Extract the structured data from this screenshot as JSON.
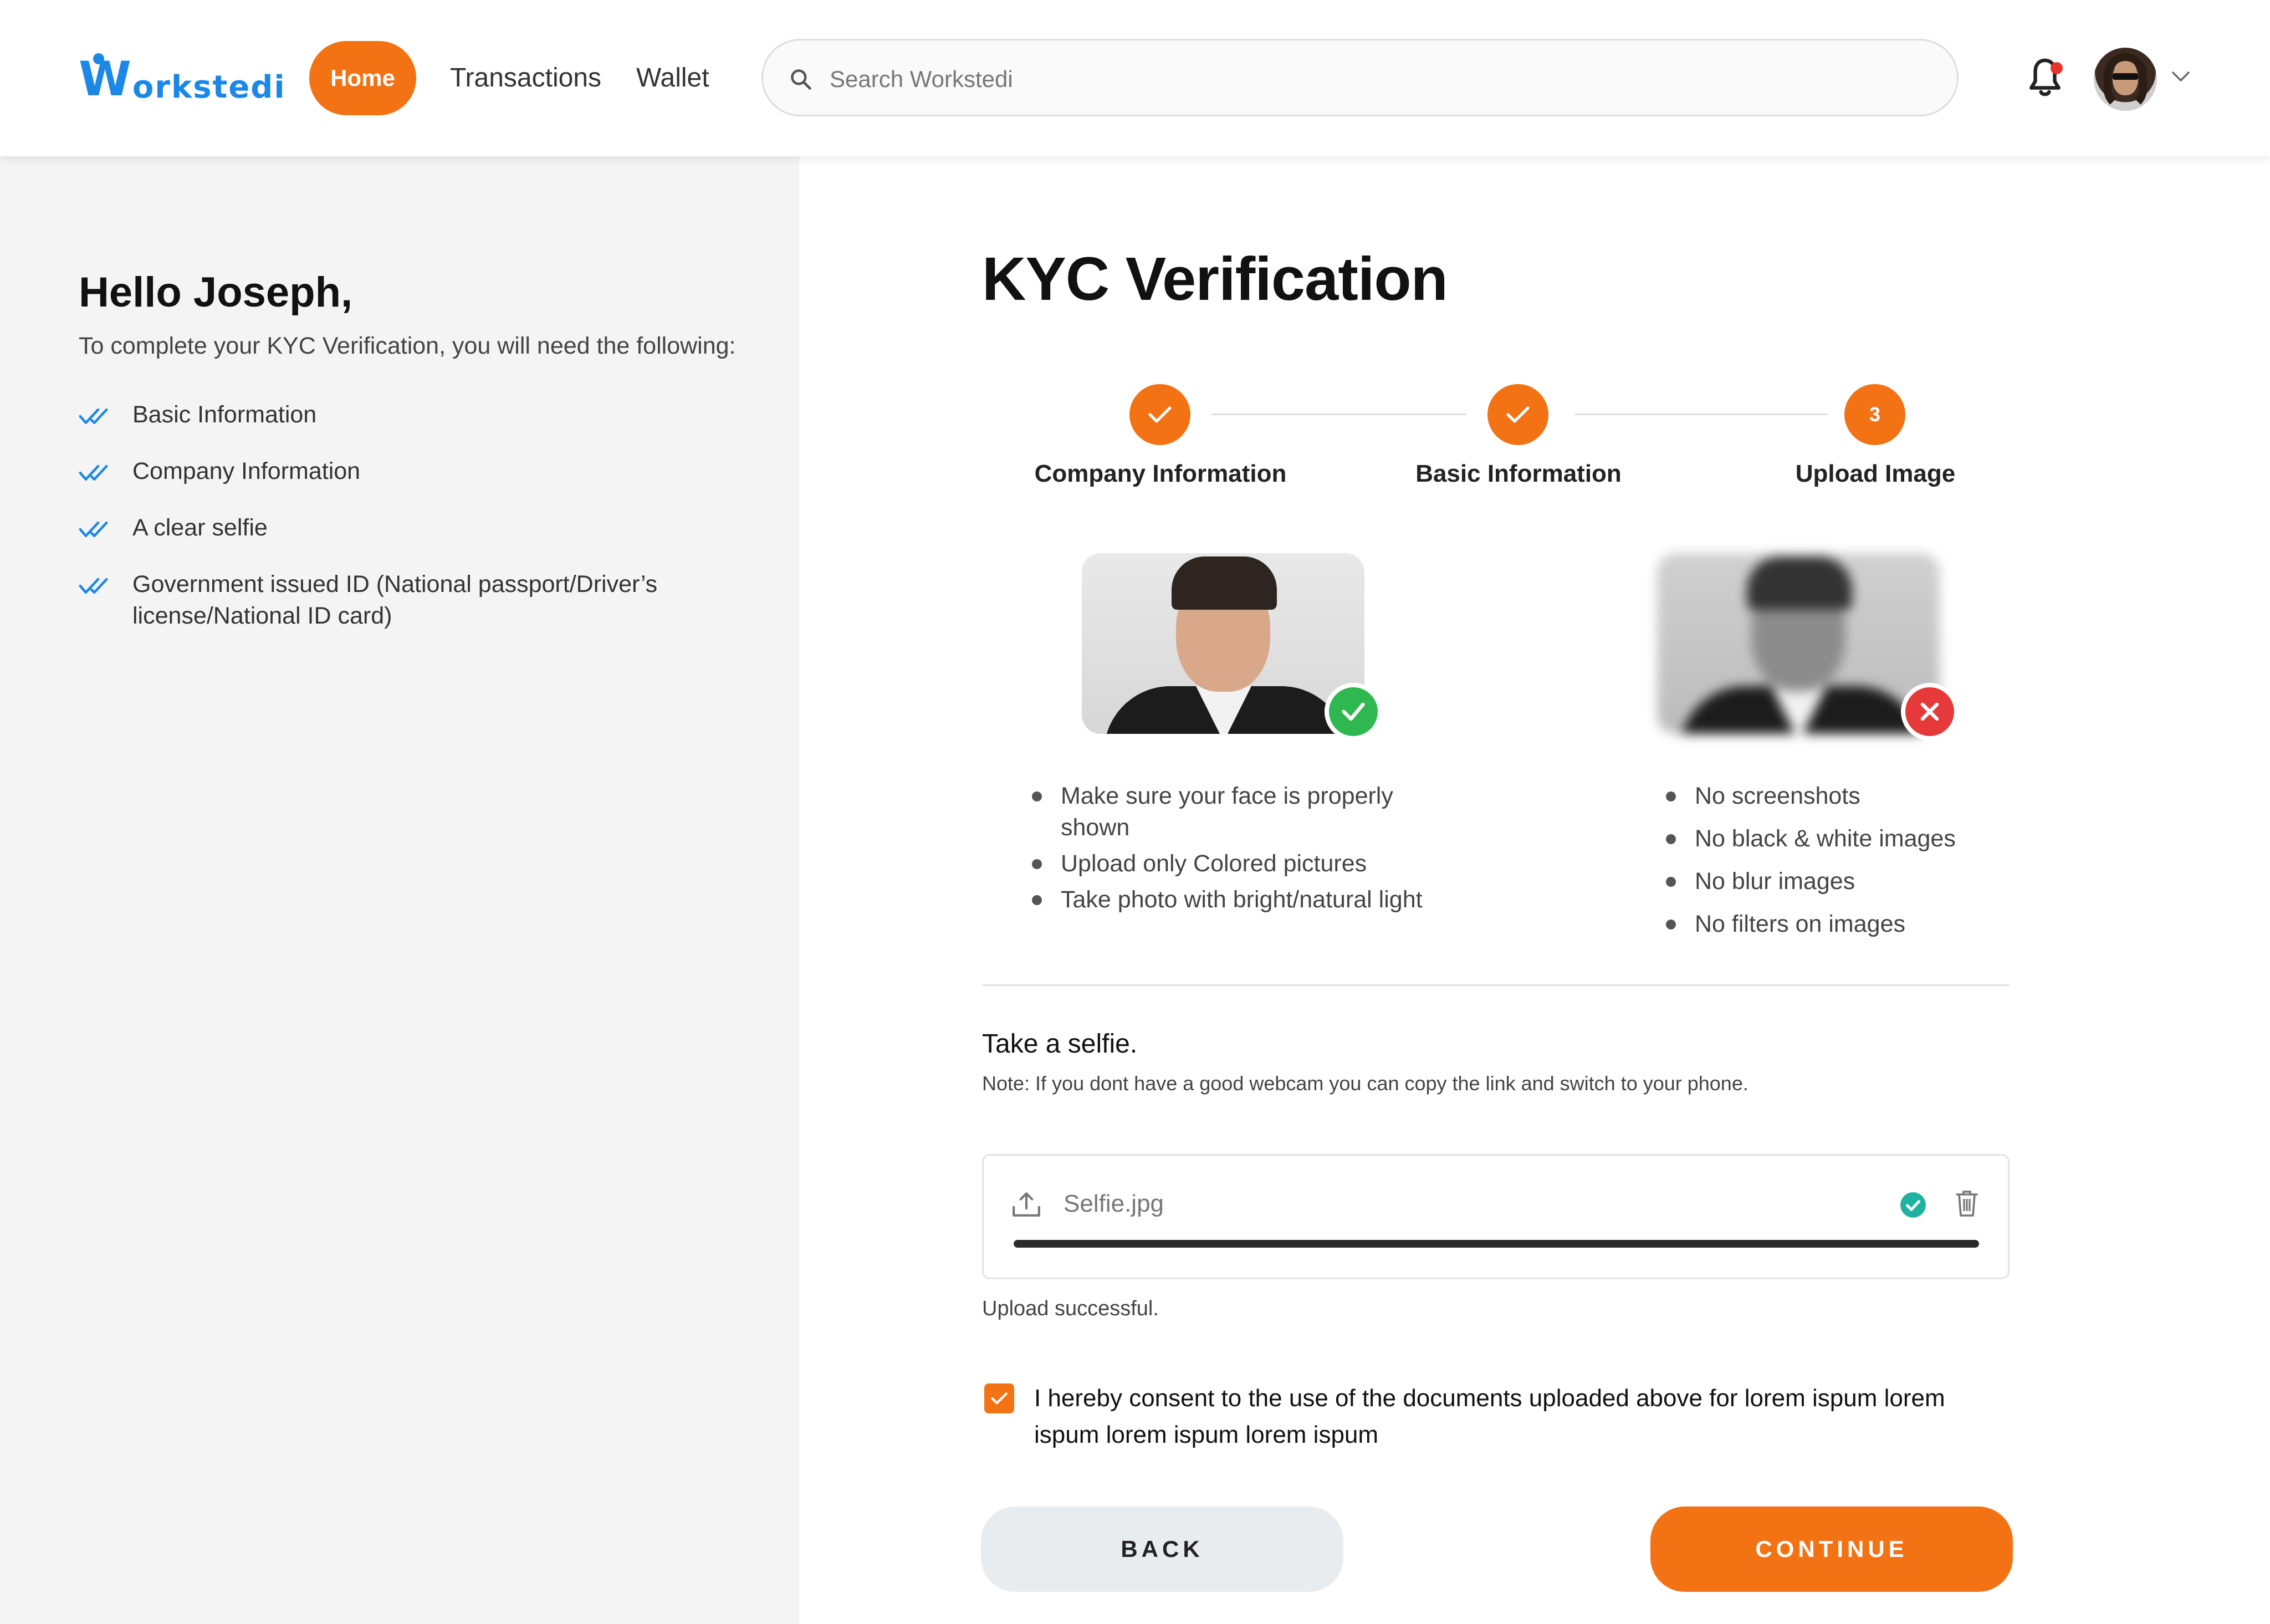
{
  "header": {
    "logo": "Workstedi",
    "logo_w": "W",
    "logo_rest": "orkstedi",
    "nav": {
      "home": "Home",
      "transactions": "Transactions",
      "wallet": "Wallet"
    },
    "search": {
      "placeholder": "Search Workstedi"
    },
    "notification_has_unread": true,
    "icons": [
      "search-icon",
      "bell-icon",
      "avatar",
      "chevron-down-icon"
    ]
  },
  "sidebar": {
    "greeting": "Hello Joseph,",
    "intro": "To complete your KYC Verification, you will need the following:",
    "requirements": [
      "Basic Information",
      "Company Information",
      "A clear selfie",
      "Government issued ID (National passport/Driver’s license/National ID card)"
    ]
  },
  "main": {
    "title": "KYC Verification",
    "steps": [
      {
        "label": "Company Information",
        "status": "done",
        "marker": ""
      },
      {
        "label": "Basic Information",
        "status": "done",
        "marker": ""
      },
      {
        "label": "Upload Image",
        "status": "current",
        "marker": "3"
      }
    ],
    "good_example": {
      "rules": [
        "Make sure your face is properly shown",
        "Upload only Colored pictures",
        "Take photo with bright/natural light"
      ]
    },
    "bad_example": {
      "rules": [
        "No screenshots",
        "No black & white images",
        "No blur images",
        "No filters on images"
      ]
    },
    "selfie": {
      "title": "Take a selfie.",
      "note": "Note: If you dont have a good webcam you can copy the link and switch to your phone.",
      "file_name": "Selfie.jpg",
      "progress": 1.0,
      "status": "Upload successful."
    },
    "consent": {
      "checked": true,
      "text": "I hereby consent to the use of the documents uploaded above for lorem ispum lorem ispum lorem ispum lorem ispum"
    },
    "buttons": {
      "back": "BACK",
      "continue": "CONTINUE"
    }
  },
  "colors": {
    "accent": "#f27214",
    "brand": "#1b87e6",
    "success": "#2fb84f",
    "error": "#e63939",
    "upload_ok": "#1fb2a0"
  }
}
